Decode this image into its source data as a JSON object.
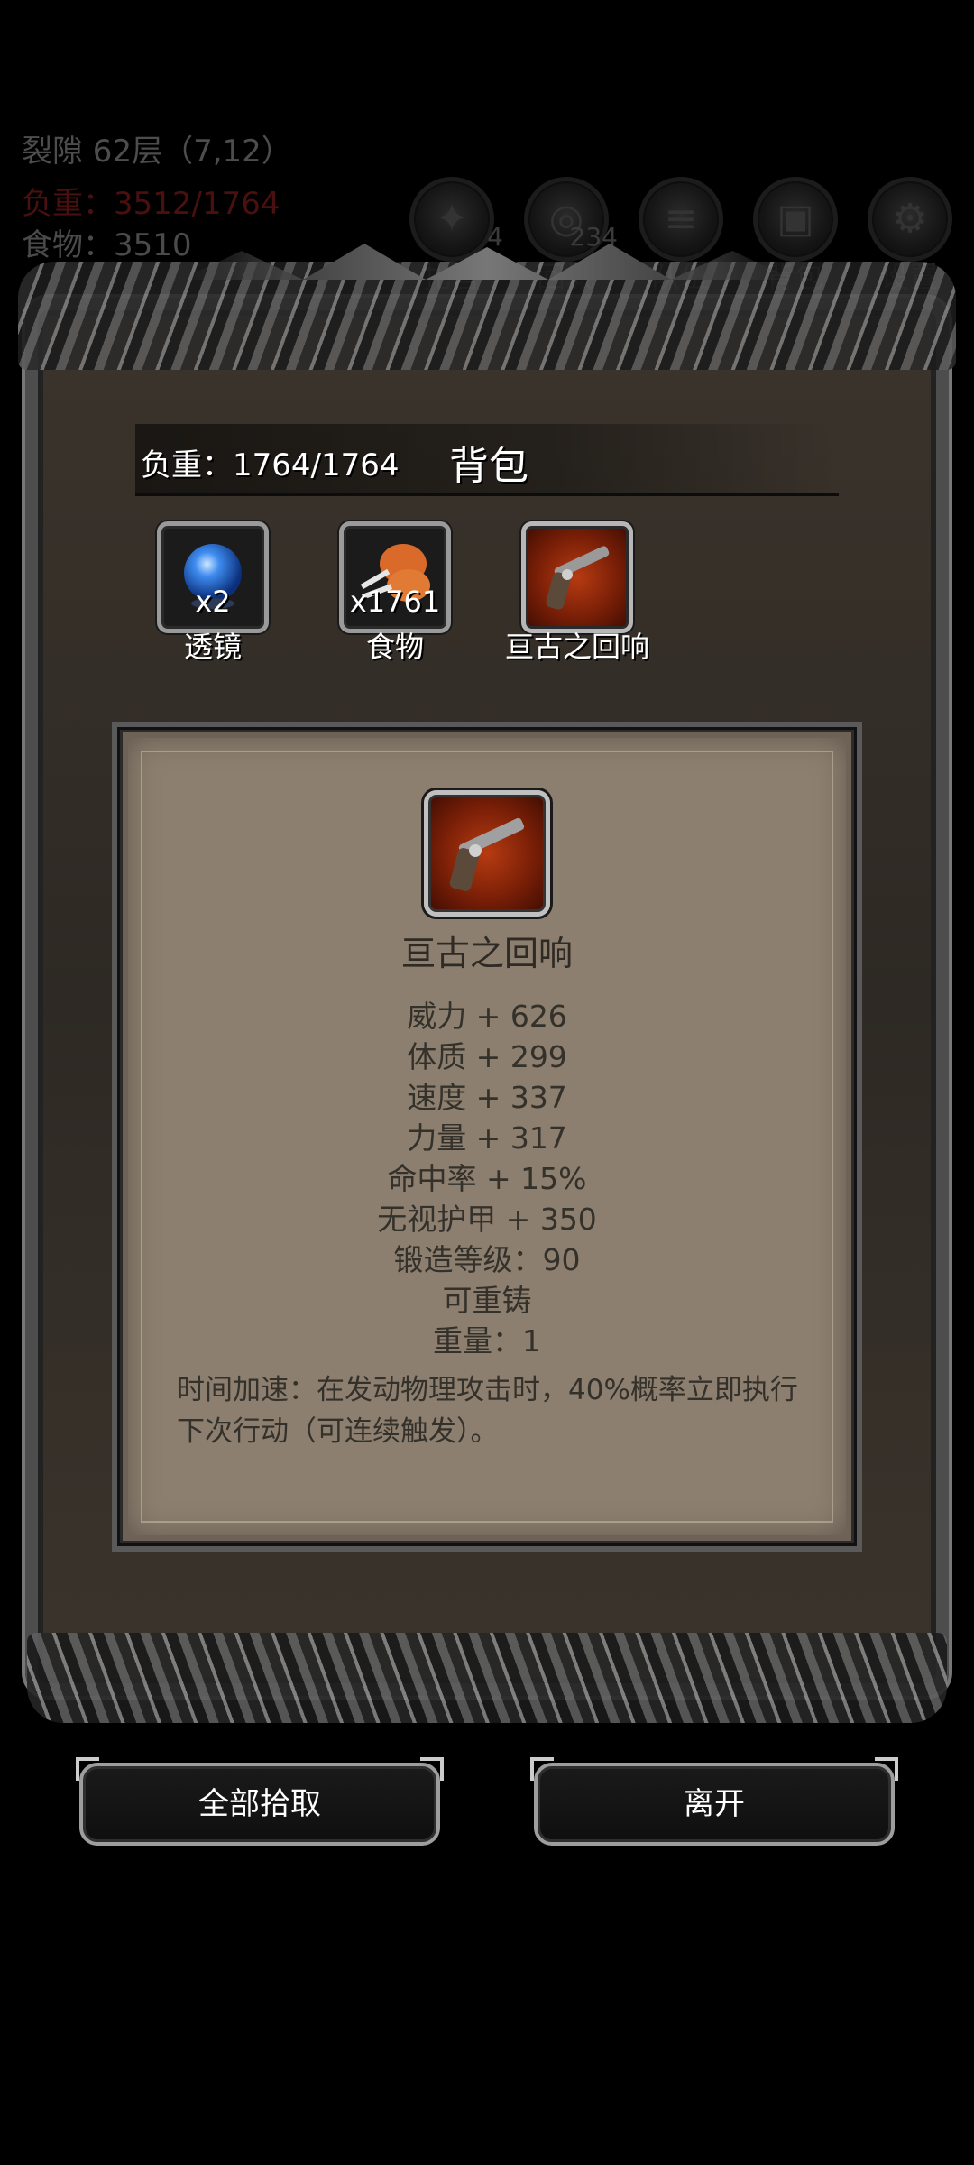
{
  "hud": {
    "location": "裂隙 62层（7,12）",
    "weight": "负重：3512/1764",
    "food": "食物：3510",
    "nav": [
      {
        "label": "扎营",
        "count": "4",
        "icon": "campfire-icon"
      },
      {
        "label": "回城",
        "count": "234",
        "icon": "portal-icon"
      },
      {
        "label": "队伍",
        "icon": "banner-icon"
      },
      {
        "label": "背包",
        "icon": "backpack-icon"
      },
      {
        "label": "设置",
        "icon": "gear-icon"
      }
    ]
  },
  "panel": {
    "capacity": "负重：1764/1764",
    "title": "背包"
  },
  "inventory": [
    {
      "name": "透镜",
      "qty": "x2",
      "icon": "blue-orb-icon"
    },
    {
      "name": "食物",
      "qty": "x1761",
      "icon": "meat-icon"
    },
    {
      "name": "亘古之回响",
      "icon": "pistol-icon"
    }
  ],
  "detail": {
    "name": "亘古之回响",
    "icon": "pistol-icon",
    "stats": [
      "威力 + 626",
      "体质 + 299",
      "速度 + 337",
      "力量 + 317",
      "命中率 + 15%",
      "无视护甲 + 350",
      "锻造等级：90",
      "可重铸",
      "重量：1"
    ],
    "effect": "时间加速：在发动物理攻击时，40%概率立即执行下次行动（可连续触发）。"
  },
  "buttons": {
    "pickup_all": "全部拾取",
    "leave": "离开"
  },
  "colors": {
    "background": "#000000",
    "panel_parchment": "#8c7f6f",
    "weapon_slot_red": "#b63b12",
    "weight_red": "#4a0f0f"
  }
}
